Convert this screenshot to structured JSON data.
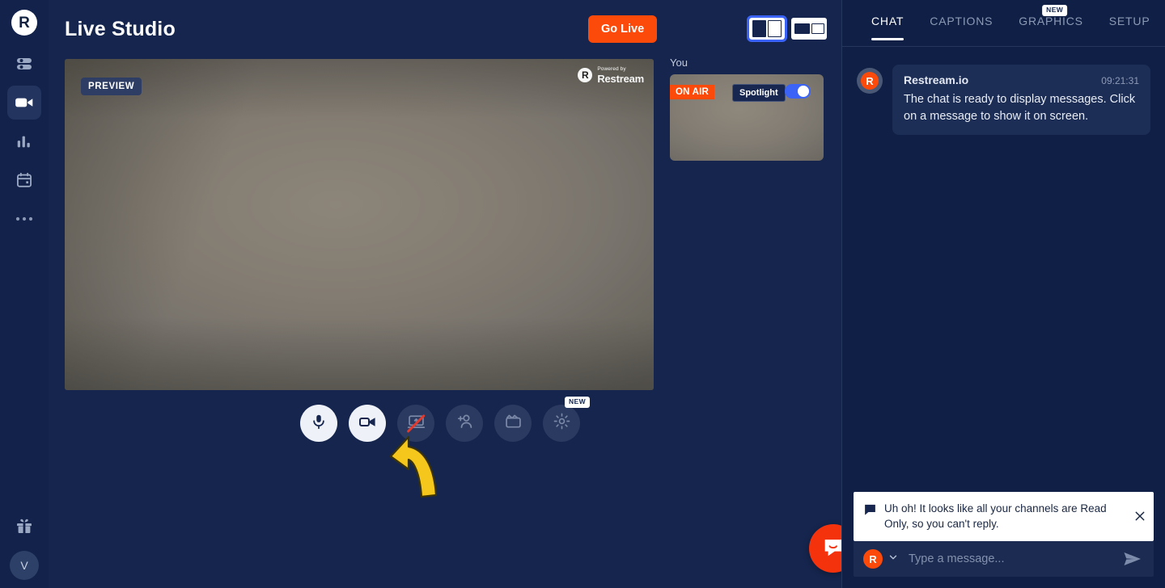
{
  "app": {
    "brand_initial": "R",
    "accent_orange": "#fc4a0a",
    "accent_blue": "#3b63f6",
    "background_navy": "#15254d",
    "panel_navy": "#0f1f45"
  },
  "sidebar": {
    "logo_label": "R",
    "items": [
      {
        "name": "dashboard",
        "icon": "sliders-icon",
        "active": false
      },
      {
        "name": "studio",
        "icon": "video-camera-icon",
        "active": true
      },
      {
        "name": "analytics",
        "icon": "bar-chart-icon",
        "active": false
      },
      {
        "name": "scheduler",
        "icon": "calendar-icon",
        "active": false
      },
      {
        "name": "more",
        "icon": "ellipsis-icon",
        "active": false
      }
    ],
    "gift_icon": "gift-icon",
    "avatar_label": "V"
  },
  "header": {
    "title": "Live Studio",
    "go_live_label": "Go Live",
    "layout_options": [
      {
        "name": "layout-split-vertical",
        "selected": true
      },
      {
        "name": "layout-picture-in-picture",
        "selected": false
      }
    ]
  },
  "preview": {
    "badge": "PREVIEW",
    "watermark_top": "Powered by",
    "watermark_bottom": "Restream",
    "watermark_mark": "R"
  },
  "participants": {
    "label": "You",
    "tiles": [
      {
        "on_air_label": "ON AIR",
        "spotlight_label": "Spotlight",
        "spotlight_enabled": true
      }
    ]
  },
  "controls": [
    {
      "name": "microphone-toggle",
      "icon": "microphone-icon",
      "style": "light",
      "disabled_slash": false,
      "badge": null
    },
    {
      "name": "camera-toggle",
      "icon": "video-camera-icon",
      "style": "light",
      "disabled_slash": false,
      "badge": null
    },
    {
      "name": "screen-share-toggle",
      "icon": "screen-share-icon",
      "style": "dark",
      "disabled_slash": true,
      "badge": null
    },
    {
      "name": "invite-guest",
      "icon": "add-person-icon",
      "style": "dark",
      "disabled_slash": false,
      "badge": null
    },
    {
      "name": "add-media",
      "icon": "clapperboard-icon",
      "style": "dark",
      "disabled_slash": false,
      "badge": null
    },
    {
      "name": "settings",
      "icon": "gear-icon",
      "style": "dark",
      "disabled_slash": false,
      "badge": "NEW"
    }
  ],
  "annotation": {
    "name": "yellow-curved-arrow",
    "color": "#f5c61b",
    "points_to": "screen-share-toggle"
  },
  "support": {
    "launcher_icon": "intercom-chat-icon",
    "launcher_color": "#f4330c"
  },
  "chat": {
    "tabs": [
      {
        "label": "CHAT",
        "active": true,
        "badge": null
      },
      {
        "label": "CAPTIONS",
        "active": false,
        "badge": null
      },
      {
        "label": "GRAPHICS",
        "active": false,
        "badge": "NEW"
      },
      {
        "label": "SETUP",
        "active": false,
        "badge": null
      }
    ],
    "messages": [
      {
        "avatar_initial": "R",
        "author": "Restream.io",
        "time": "09:21:31",
        "text": "The chat is ready to display messages. Click on a message to show it on screen."
      }
    ],
    "notice": {
      "icon": "chat-bubble-icon",
      "text": "Uh oh! It looks like all your channels are Read Only, so you can't reply.",
      "close_icon": "close-icon"
    },
    "composer": {
      "avatar_initial": "R",
      "dropdown_icon": "chevron-down-icon",
      "placeholder": "Type a message...",
      "value": "",
      "send_icon": "send-icon"
    }
  }
}
